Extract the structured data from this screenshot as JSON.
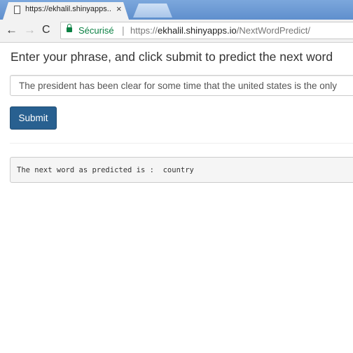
{
  "browser": {
    "tab_title": "https://ekhalil.shinyapps...",
    "tab_close": "×",
    "nav": {
      "back_icon": "←",
      "forward_icon": "→",
      "reload_icon": "C"
    },
    "secure_label": "Sécurisé",
    "url_separator": "|",
    "url_scheme": "https://",
    "url_host": "ekhalil.shinyapps.io",
    "url_path": "/NextWordPredict/"
  },
  "page": {
    "title": "Enter your phrase, and click submit to predict the next word",
    "phrase_value": "The president has been clear for some time that the united states is the only",
    "submit_label": "Submit",
    "output_text": "The next word as predicted is :  country"
  },
  "colors": {
    "button_bg": "#286090",
    "secure_green": "#0b8043",
    "output_bg": "#f5f5f5"
  }
}
